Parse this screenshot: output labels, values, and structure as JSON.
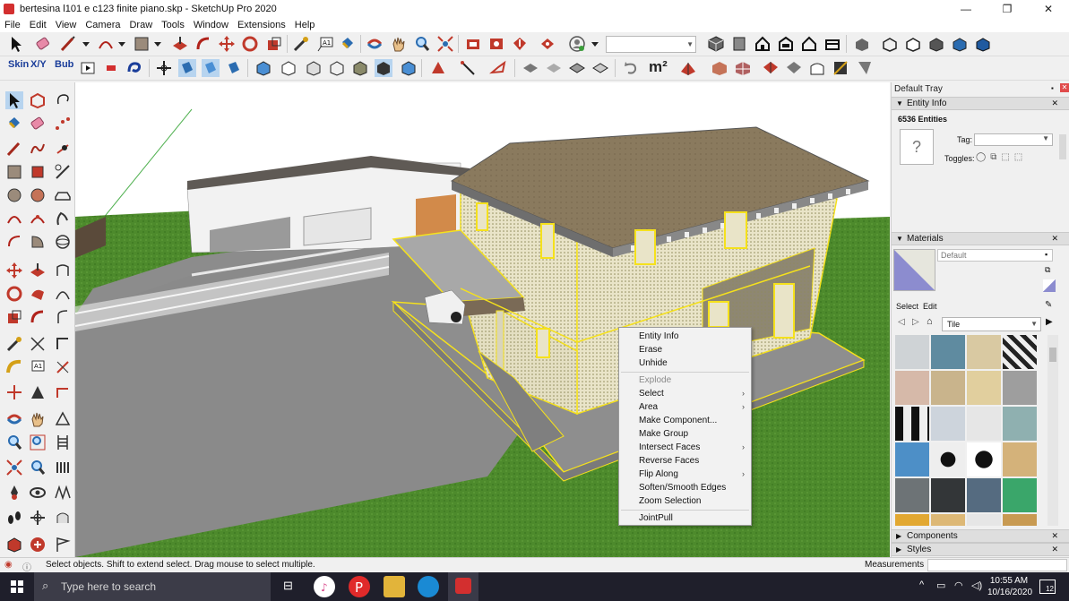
{
  "window": {
    "title": "bertesina l101 e c123 finite piano.skp - SketchUp Pro 2020",
    "minimize": "—",
    "maximize": "❐",
    "close": "✕"
  },
  "menu": [
    "File",
    "Edit",
    "View",
    "Camera",
    "Draw",
    "Tools",
    "Window",
    "Extensions",
    "Help"
  ],
  "toolbar": {
    "skin_label": "Skin",
    "xyz_label": "X/Y",
    "bub_label": "Bub",
    "area_unit_label": "m²"
  },
  "context_menu": {
    "items": [
      {
        "label": "Entity Info",
        "enabled": true,
        "submenu": false
      },
      {
        "label": "Erase",
        "enabled": true,
        "submenu": false
      },
      {
        "label": "Unhide",
        "enabled": true,
        "submenu": false
      },
      {
        "label": "Explode",
        "enabled": false,
        "submenu": false
      },
      {
        "label": "Select",
        "enabled": true,
        "submenu": true
      },
      {
        "label": "Area",
        "enabled": true,
        "submenu": true
      },
      {
        "label": "Make Component...",
        "enabled": true,
        "submenu": false
      },
      {
        "label": "Make Group",
        "enabled": true,
        "submenu": false
      },
      {
        "label": "Intersect Faces",
        "enabled": true,
        "submenu": true
      },
      {
        "label": "Reverse Faces",
        "enabled": true,
        "submenu": false
      },
      {
        "label": "Flip Along",
        "enabled": true,
        "submenu": true
      },
      {
        "label": "Soften/Smooth Edges",
        "enabled": true,
        "submenu": false
      },
      {
        "label": "Zoom Selection",
        "enabled": true,
        "submenu": false
      },
      {
        "label": "JointPull",
        "enabled": true,
        "submenu": false
      }
    ]
  },
  "tray": {
    "title": "Default Tray",
    "entity_info": {
      "header": "Entity Info",
      "count": "6536 Entities",
      "preview_icon": "?",
      "tag_label": "Tag:",
      "tag_value": "",
      "toggles_label": "Toggles:"
    },
    "materials": {
      "header": "Materials",
      "material_name": "Default",
      "tab_select": "Select",
      "tab_edit": "Edit",
      "collection": "Tile"
    },
    "components": {
      "header": "Components"
    },
    "styles": {
      "header": "Styles"
    }
  },
  "status": {
    "hint": "Select objects. Shift to extend select. Drag mouse to select multiple.",
    "measurements_label": "Measurements",
    "measurements_value": ""
  },
  "taskbar": {
    "search_placeholder": "Type here to search",
    "time": "10:55 AM",
    "date": "10/16/2020",
    "notification_count": "12"
  },
  "colors": {
    "grass": "#4f8a2e",
    "roof": "#8a7a5e",
    "wall": "#e9e4c8",
    "selection": "#f5e11c",
    "road": "#8c8c8c",
    "accent_blue": "#1a3d9a"
  }
}
